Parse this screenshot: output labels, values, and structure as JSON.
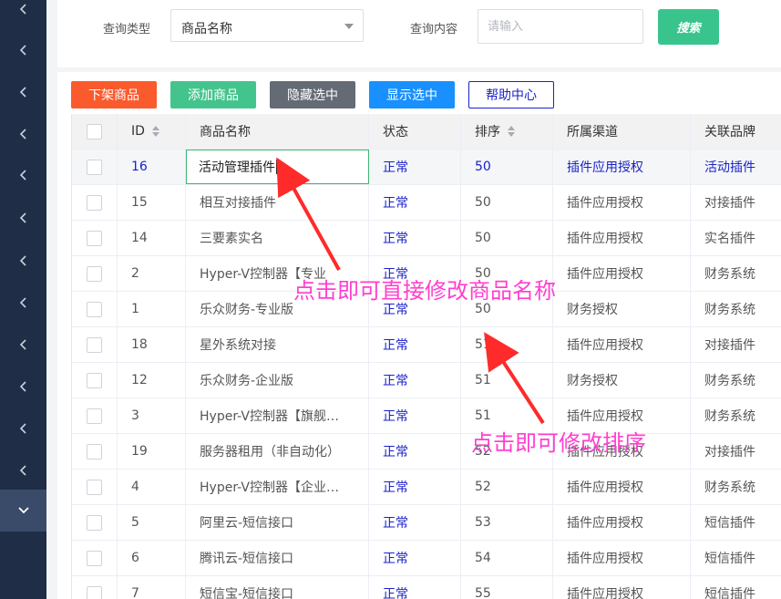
{
  "search": {
    "type_label": "查询类型",
    "type_value": "商品名称",
    "content_label": "查询内容",
    "content_placeholder": "请输入",
    "search_button": "搜索"
  },
  "actions": [
    {
      "label": "下架商品",
      "color": "#fb5a2d"
    },
    {
      "label": "添加商品",
      "color": "#44c48d"
    },
    {
      "label": "隐藏选中",
      "color": "#646b75"
    },
    {
      "label": "显示选中",
      "color": "#1890ff"
    },
    {
      "label": "帮助中心",
      "color": "#ffffff"
    }
  ],
  "table": {
    "columns": [
      "ID",
      "商品名称",
      "状态",
      "排序",
      "所属渠道",
      "关联品牌"
    ],
    "rows": [
      {
        "id": "16",
        "name": "活动管理插件",
        "status": "正常",
        "sort": "50",
        "channel": "插件应用授权",
        "brand": "活动插件"
      },
      {
        "id": "15",
        "name": "相互对接插件",
        "status": "正常",
        "sort": "50",
        "channel": "插件应用授权",
        "brand": "对接插件"
      },
      {
        "id": "14",
        "name": "三要素实名",
        "status": "正常",
        "sort": "50",
        "channel": "插件应用授权",
        "brand": "实名插件"
      },
      {
        "id": "2",
        "name": "Hyper-V控制器【专业",
        "status": "正常",
        "sort": "50",
        "channel": "插件应用授权",
        "brand": "财务系统"
      },
      {
        "id": "1",
        "name": "乐众财务-专业版",
        "status": "正常",
        "sort": "50",
        "channel": "财务授权",
        "brand": "财务系统"
      },
      {
        "id": "18",
        "name": "星外系统对接",
        "status": "正常",
        "sort": "51",
        "channel": "插件应用授权",
        "brand": "对接插件"
      },
      {
        "id": "12",
        "name": "乐众财务-企业版",
        "status": "正常",
        "sort": "51",
        "channel": "财务授权",
        "brand": "财务系统"
      },
      {
        "id": "3",
        "name": "Hyper-V控制器【旗舰…",
        "status": "正常",
        "sort": "51",
        "channel": "插件应用授权",
        "brand": "财务系统"
      },
      {
        "id": "19",
        "name": "服务器租用（非自动化）",
        "status": "正常",
        "sort": "52",
        "channel": "插件应用授权",
        "brand": "对接插件"
      },
      {
        "id": "4",
        "name": "Hyper-V控制器【企业…",
        "status": "正常",
        "sort": "52",
        "channel": "插件应用授权",
        "brand": "财务系统"
      },
      {
        "id": "5",
        "name": "阿里云-短信接口",
        "status": "正常",
        "sort": "53",
        "channel": "插件应用授权",
        "brand": "短信插件"
      },
      {
        "id": "6",
        "name": "腾讯云-短信接口",
        "status": "正常",
        "sort": "54",
        "channel": "插件应用授权",
        "brand": "短信插件"
      },
      {
        "id": "7",
        "name": "短信宝-短信接口",
        "status": "正常",
        "sort": "55",
        "channel": "插件应用授权",
        "brand": "短信插件"
      }
    ]
  },
  "annotations": {
    "edit_name": "点击即可直接修改商品名称",
    "edit_sort": "点击即可修改排序"
  },
  "colors": {
    "annotation": "#ff3fcf",
    "link_blue": "#1a22c9",
    "sidebar": "#1f2d47"
  }
}
